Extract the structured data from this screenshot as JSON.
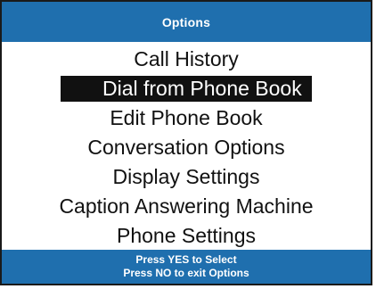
{
  "header": {
    "title": "Options"
  },
  "menu": {
    "selected_index": 1,
    "items": [
      {
        "label": "Call History"
      },
      {
        "label": "Dial from Phone Book"
      },
      {
        "label": "Edit Phone Book"
      },
      {
        "label": "Conversation Options"
      },
      {
        "label": "Display Settings"
      },
      {
        "label": "Caption Answering Machine"
      },
      {
        "label": "Phone Settings"
      }
    ]
  },
  "footer": {
    "line1": "Press YES to Select",
    "line2": "Press NO to exit Options"
  },
  "colors": {
    "title_bar_bg": "#1f6fae",
    "selection_bg": "#111111",
    "text": "#111111"
  }
}
